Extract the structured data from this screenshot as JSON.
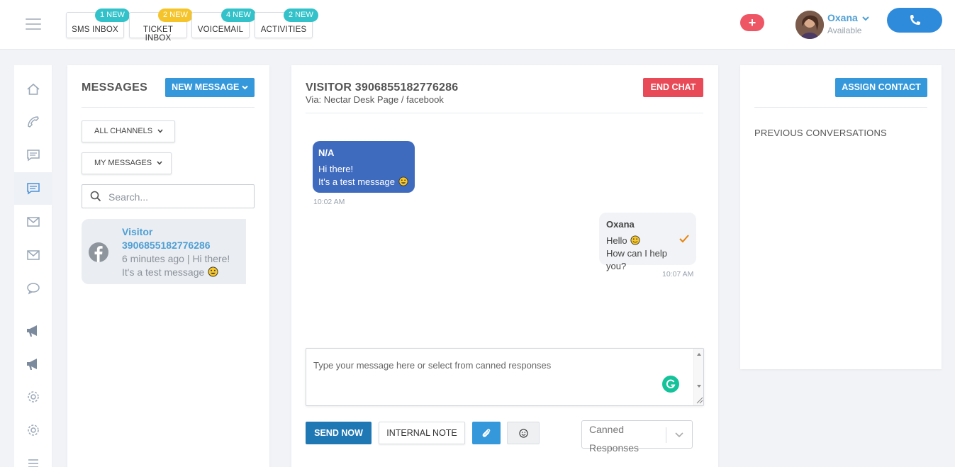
{
  "topbar": {
    "tabs": [
      {
        "label": "SMS INBOX",
        "badge": "1 NEW",
        "badge_color": "#33c2c9"
      },
      {
        "label": "TICKET INBOX",
        "badge": "2 NEW",
        "badge_color": "#f5c42a"
      },
      {
        "label": "VOICEMAIL",
        "badge": "4 NEW",
        "badge_color": "#33c2c9"
      },
      {
        "label": "ACTIVITIES",
        "badge": "2 NEW",
        "badge_color": "#33c2c9"
      }
    ],
    "plus_label": "+",
    "user": {
      "name": "Oxana",
      "status": "Available"
    }
  },
  "leftnav": {
    "items": [
      "home-icon",
      "phone-icon",
      "sms-icon",
      "chat-icon",
      "mail-icon",
      "mail-icon",
      "comment-icon",
      "megaphone-icon",
      "megaphone-icon",
      "gear-icon",
      "gear-icon",
      "list-icon"
    ],
    "active_index": 3
  },
  "messages": {
    "title": "MESSAGES",
    "new_message_label": "NEW MESSAGE",
    "channels_filter": "ALL CHANNELS",
    "owner_filter": "MY MESSAGES",
    "search_placeholder": "Search...",
    "conversations": [
      {
        "name": "Visitor 3906855182776286",
        "preview": "6 minutes ago | Hi there! It's a test message",
        "channel": "facebook-icon"
      }
    ]
  },
  "chat": {
    "title": "VISITOR 3906855182776286",
    "subtitle": "Via: Nectar Desk Page / facebook",
    "end_chat_label": "END CHAT",
    "messages": [
      {
        "sender": "N/A",
        "lines": [
          "Hi there!",
          "It's a test message"
        ],
        "time": "10:02 AM",
        "direction": "in"
      },
      {
        "sender": "Oxana",
        "lines": [
          "Hello",
          "How can I help you?"
        ],
        "time": "10:07 AM",
        "direction": "out"
      }
    ],
    "composer_placeholder": "Type your message here or select from canned responses",
    "send_label": "SEND NOW",
    "note_label": "INTERNAL NOTE",
    "canned_value": "Canned Responses"
  },
  "right": {
    "assign_label": "ASSIGN CONTACT",
    "previous_label": "PREVIOUS CONVERSATIONS"
  }
}
